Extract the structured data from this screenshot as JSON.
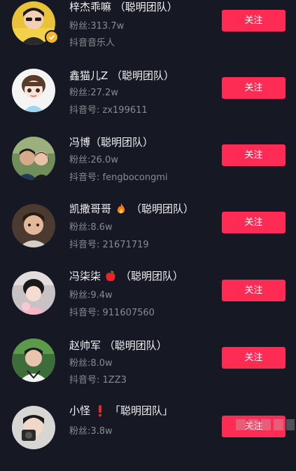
{
  "users": [
    {
      "name": "梓杰乖嘛 （聪明团队）",
      "fans": "粉丝:313.7w",
      "sub": "抖音音乐人",
      "verified": true,
      "button": "关注"
    },
    {
      "name": "鑫猫儿Z （聪明团队）",
      "fans": "粉丝:27.2w",
      "sub": "抖音号: zx199611",
      "button": "关注"
    },
    {
      "name": "冯博（聪明团队）",
      "fans": "粉丝:26.0w",
      "sub": "抖音号: fengbocongmi",
      "button": "关注"
    },
    {
      "name_before": "凯撒哥哥",
      "name_after": "（聪明团队）",
      "emoji": "fire-emoji",
      "fans": "粉丝:8.6w",
      "sub": "抖音号: 21671719",
      "button": "关注"
    },
    {
      "name_before": "冯柒柒",
      "name_after": "（聪明团队）",
      "emoji": "apple-emoji",
      "fans": "粉丝:9.4w",
      "sub": "抖音号: 911607560",
      "button": "关注"
    },
    {
      "name": "赵帅军 （聪明团队）",
      "fans": "粉丝:8.0w",
      "sub": "抖音号: 1ZZ3",
      "button": "关注"
    },
    {
      "name_before": "小怪",
      "name_after": "「聪明团队」",
      "emoji": "exclamation-emoji",
      "fans": "粉丝:3.8w",
      "button": "关注"
    }
  ],
  "colors": {
    "background": "#161823",
    "accent": "#fe2c55",
    "secondary_text": "#8a8b91",
    "verified_badge": "#f7b52c"
  }
}
